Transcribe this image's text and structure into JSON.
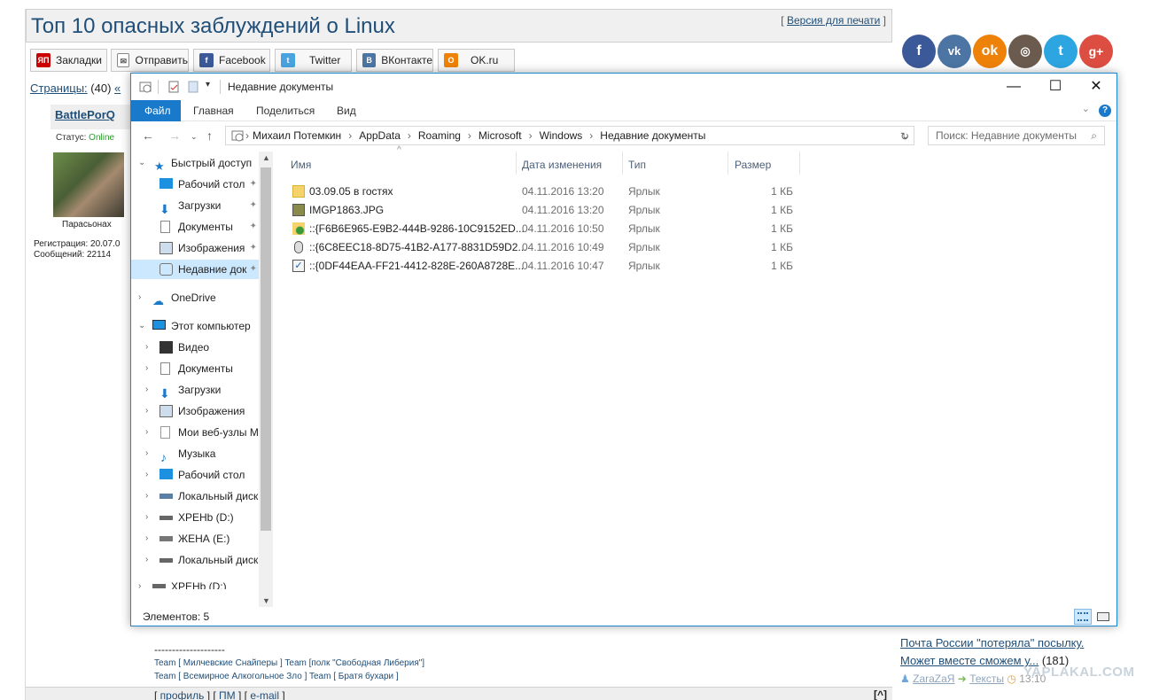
{
  "forum": {
    "title": "Топ 10 опасных заблуждений о Linux",
    "print_link": "Версия для печати",
    "share": [
      "Закладки",
      "Отправить",
      "Facebook",
      "Twitter",
      "ВКонтакте",
      "OK.ru"
    ],
    "pages_label": "Страницы:",
    "pages_count": "(40)",
    "pages_prev": "«",
    "author": "BattlePorQ",
    "status_label": "Статус:",
    "status_value": "Online",
    "avatar_caption": "Парасьонах",
    "registration": "Регистрация: 20.07.0",
    "messages": "Сообщений: 22114",
    "sig_dashes": "--------------------",
    "sig_line1_prefix": "Team [",
    "sig_line1_a": "Милчевские Снайперы",
    "sig_line1_mid": "] Team [",
    "sig_line1_b": "полк \"Свободная Либерия\"",
    "sig_line1_end": "]",
    "sig_line2_a": "Всемирное Алкогольное Зло",
    "sig_line2_b": "Братя бухари",
    "footer_profile": "профиль",
    "footer_pm": "ПМ",
    "footer_email": "e-mail",
    "footer_up": "[^]",
    "social": [
      "f",
      "vk",
      "ok",
      "ig",
      "tw",
      "g+"
    ]
  },
  "rightcol": {
    "link1": "Почта России \"потеряла\" посылку.",
    "link2": "Может вместе сможем у...",
    "count": "(181)",
    "user": "ZaraZaЯ",
    "section": "Тексты",
    "time": "13:10",
    "watermark": "YAPLAKAL.COM"
  },
  "explorer": {
    "title": "Недавние документы",
    "tabs": [
      "Файл",
      "Главная",
      "Поделиться",
      "Вид"
    ],
    "path": [
      "Михаил Потемкин",
      "AppData",
      "Roaming",
      "Microsoft",
      "Windows",
      "Недавние документы"
    ],
    "search_placeholder": "Поиск: Недавние документы",
    "nav": {
      "quick": "Быстрый доступ",
      "desktop": "Рабочий стол",
      "downloads": "Загрузки",
      "documents": "Документы",
      "images": "Изображения",
      "recent": "Недавние док",
      "onedrive": "OneDrive",
      "pc": "Этот компьютер",
      "video": "Видео",
      "documents2": "Документы",
      "downloads2": "Загрузки",
      "images2": "Изображения",
      "web": "Мои веб-узлы M",
      "music": "Музыка",
      "desktop2": "Рабочий стол",
      "local1": "Локальный диск",
      "d": "XPEHb (D:)",
      "e": "ЖЕНА (E:)",
      "local2": "Локальный диск",
      "d2": "XPEHb (D:)"
    },
    "columns": [
      "Имя",
      "Дата изменения",
      "Тип",
      "Размер"
    ],
    "files": [
      {
        "name": "03.09.05 в гостях",
        "date": "04.11.2016 13:20",
        "type": "Ярлык",
        "size": "1 КБ"
      },
      {
        "name": "IMGP1863.JPG",
        "date": "04.11.2016 13:20",
        "type": "Ярлык",
        "size": "1 КБ"
      },
      {
        "name": "::{F6B6E965-E9B2-444B-9286-10C9152ED...",
        "date": "04.11.2016 10:50",
        "type": "Ярлык",
        "size": "1 КБ"
      },
      {
        "name": "::{6C8EEC18-8D75-41B2-A177-8831D59D2...",
        "date": "04.11.2016 10:49",
        "type": "Ярлык",
        "size": "1 КБ"
      },
      {
        "name": "::{0DF44EAA-FF21-4412-828E-260A8728E...",
        "date": "04.11.2016 10:47",
        "type": "Ярлык",
        "size": "1 КБ"
      }
    ],
    "status": "Элементов: 5"
  }
}
